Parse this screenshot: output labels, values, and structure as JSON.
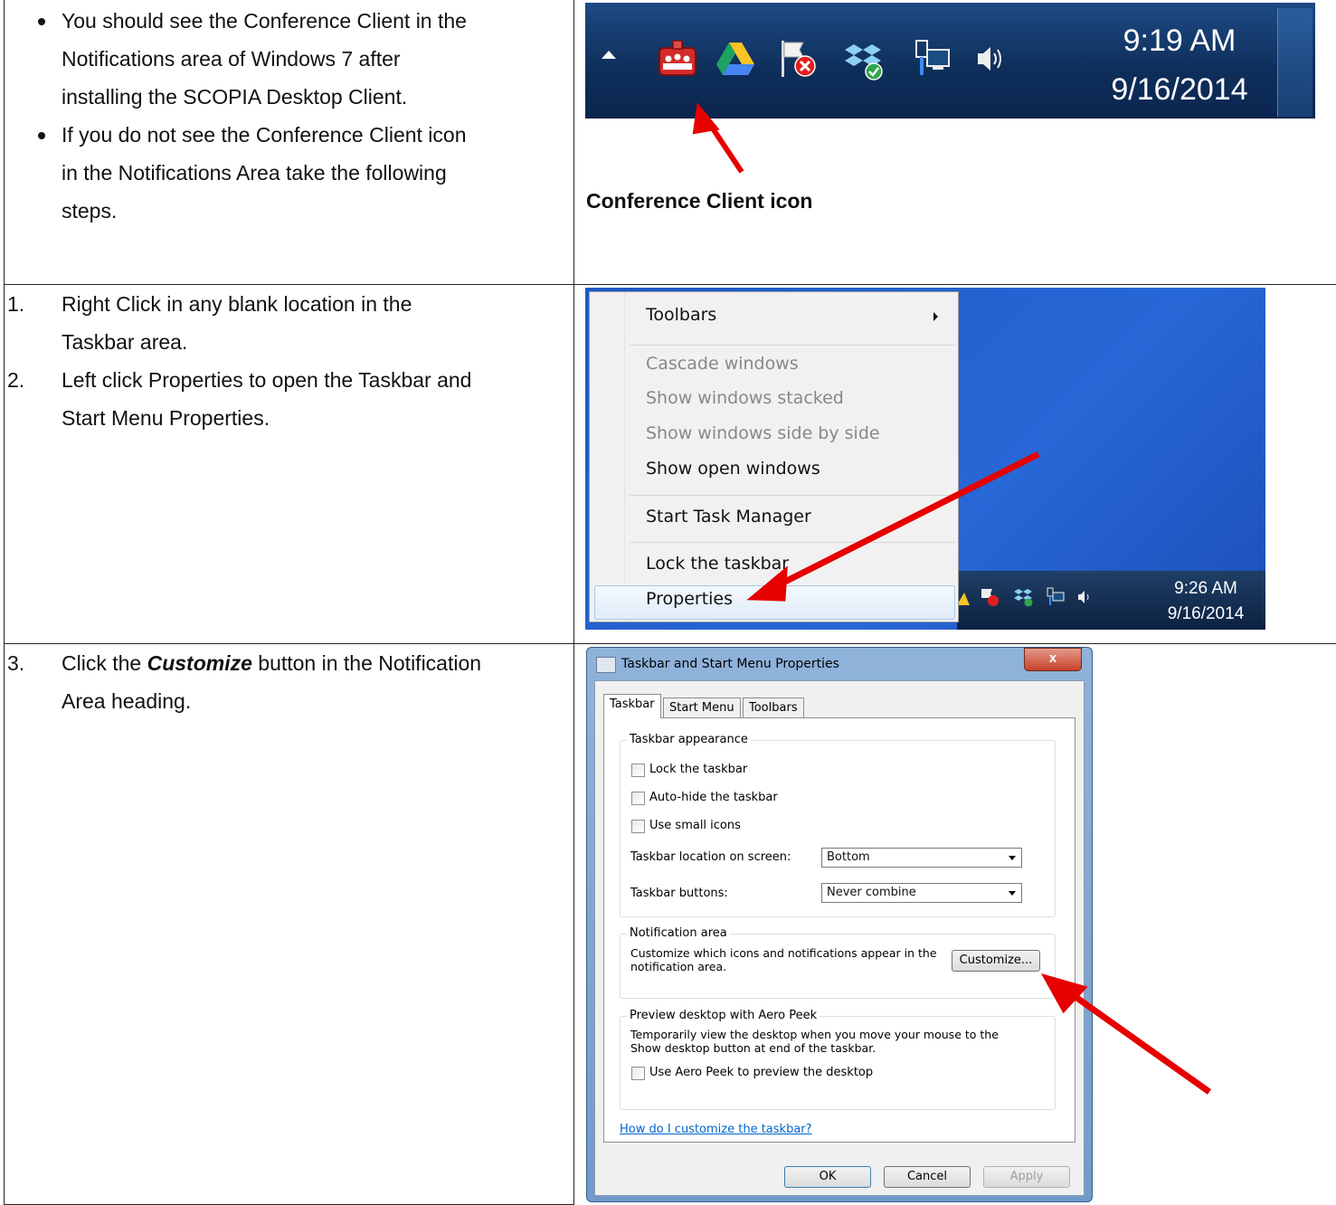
{
  "row1": {
    "bullets": [
      [
        "You should see the Conference Client in the",
        "Notifications area of Windows 7 after",
        "installing the SCOPIA Desktop Client."
      ],
      [
        "If you do not see the Conference Client icon",
        "in the Notifications Area take the following",
        "steps."
      ]
    ],
    "caption": "Conference Client icon",
    "tray": {
      "time": "9:19 AM",
      "date": "9/16/2014",
      "icons": [
        "conference-client-icon",
        "google-drive-icon",
        "action-center-flag-icon",
        "dropbox-icon",
        "network-icon",
        "volume-icon"
      ]
    }
  },
  "row2": {
    "steps": [
      {
        "num": "1.",
        "lines": [
          "Right Click in any blank location in the",
          "Taskbar area."
        ]
      },
      {
        "num": "2.",
        "lines": [
          "Left click Properties to open the Taskbar and",
          "Start Menu Properties."
        ]
      }
    ],
    "menu": {
      "toolbars": "Toolbars",
      "cascade": "Cascade windows",
      "stacked": "Show windows stacked",
      "side_by_side": "Show windows side by side",
      "show_open": "Show open windows",
      "task_manager": "Start Task Manager",
      "lock": "Lock the taskbar",
      "properties": "Properties"
    },
    "tray": {
      "time": "9:26 AM",
      "date": "9/16/2014"
    }
  },
  "row3": {
    "step_num": "3.",
    "text_before": "Click the ",
    "text_emph": "Customize",
    "text_after": " button in the Notification",
    "text_line2": "Area heading.",
    "dialog": {
      "title": "Taskbar and Start Menu Properties",
      "close": "x",
      "tabs": [
        "Taskbar",
        "Start Menu",
        "Toolbars"
      ],
      "appearance_label": "Taskbar appearance",
      "lock": "Lock the taskbar",
      "autohide": "Auto-hide the taskbar",
      "small_icons": "Use small icons",
      "location_label": "Taskbar location on screen:",
      "location_value": "Bottom",
      "buttons_label": "Taskbar buttons:",
      "buttons_value": "Never combine",
      "notif_label": "Notification area",
      "notif_text1": "Customize which icons and notifications appear in the",
      "notif_text2": "notification area.",
      "customize": "Customize...",
      "peek_label": "Preview desktop with Aero Peek",
      "peek_text1": "Temporarily view the desktop when you move your mouse to the",
      "peek_text2": "Show desktop button at end of the taskbar.",
      "peek_cb": "Use Aero Peek to preview the desktop",
      "help_link": "How do I customize the taskbar?",
      "ok": "OK",
      "cancel": "Cancel",
      "apply": "Apply"
    }
  }
}
